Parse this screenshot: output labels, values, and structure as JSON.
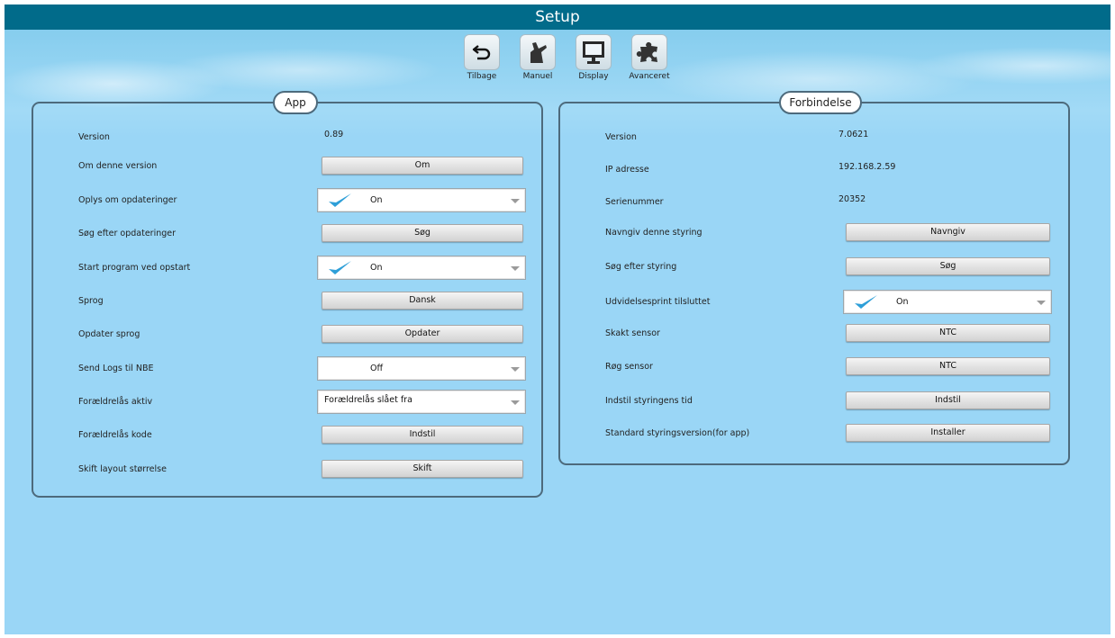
{
  "window": {
    "title": "Setup"
  },
  "toolbar": {
    "back": "Tilbage",
    "manual": "Manuel",
    "display": "Display",
    "advanced": "Avanceret"
  },
  "app_panel": {
    "title": "App",
    "version_label": "Version",
    "version_value": "0.89",
    "about_label": "Om denne version",
    "about_button": "Om",
    "notify_label": "Oplys om opdateringer",
    "notify_value": "On",
    "search_updates_label": "Søg efter opdateringer",
    "search_updates_button": "Søg",
    "autostart_label": "Start program ved opstart",
    "autostart_value": "On",
    "language_label": "Sprog",
    "language_button": "Dansk",
    "update_language_label": "Opdater sprog",
    "update_language_button": "Opdater",
    "send_logs_label": "Send Logs til NBE",
    "send_logs_value": "Off",
    "parental_active_label": "Forældrelås aktiv",
    "parental_active_value": "Forældrelås slået fra",
    "parental_code_label": "Forældrelås kode",
    "parental_code_button": "Indstil",
    "layout_size_label": "Skift layout størrelse",
    "layout_size_button": "Skift"
  },
  "connection_panel": {
    "title": "Forbindelse",
    "version_label": "Version",
    "version_value": "7.0621",
    "ip_label": "IP adresse",
    "ip_value": "192.168.2.59",
    "serial_label": "Serienummer",
    "serial_value": "20352",
    "name_label": "Navngiv denne styring",
    "name_button": "Navngiv",
    "search_label": "Søg efter styring",
    "search_button": "Søg",
    "expansion_label": "Udvidelsesprint tilsluttet",
    "expansion_value": "On",
    "shaft_sensor_label": "Skakt sensor",
    "shaft_sensor_button": "NTC",
    "smoke_sensor_label": "Røg sensor",
    "smoke_sensor_button": "NTC",
    "time_label": "Indstil styringens tid",
    "time_button": "Indstil",
    "standard_version_label": "Standard styringsversion(for app)",
    "standard_version_button": "Installer"
  },
  "colors": {
    "titlebar": "#016b8a",
    "background": "#9ad6f6",
    "panel_border": "#4d6a7c",
    "check": "#2e9fd8"
  },
  "icons": [
    "back-arrow-icon",
    "hand-icon",
    "monitor-icon",
    "puzzle-icon",
    "check-icon",
    "dropdown-arrow-icon"
  ]
}
